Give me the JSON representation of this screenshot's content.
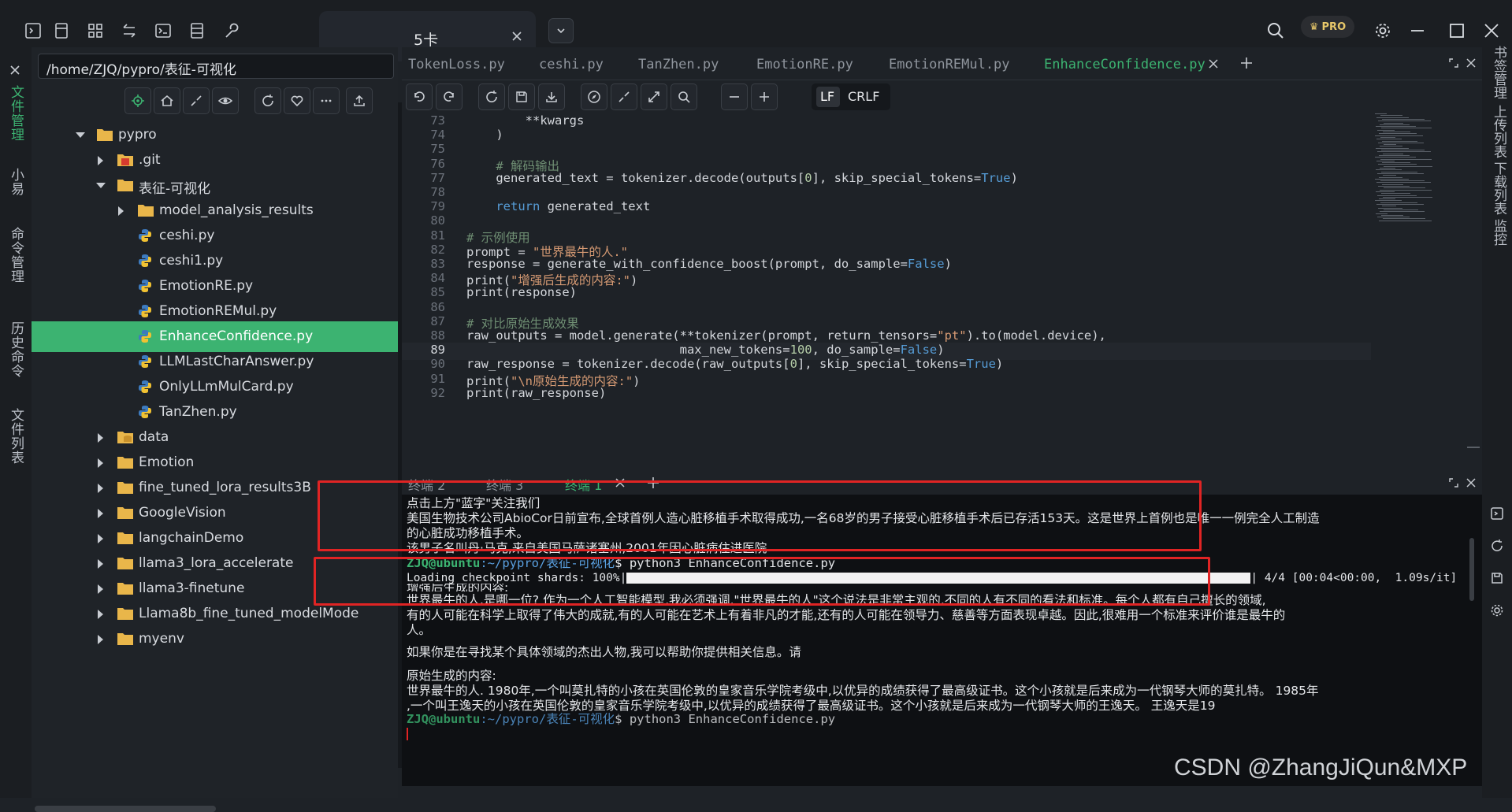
{
  "topbar": {
    "tab_title": "5卡",
    "pro_label": "PRO",
    "icons": [
      "terminal-icon",
      "bookmark-icon",
      "grid-icon",
      "transfer-icon",
      "shell-icon",
      "server-icon",
      "wrench-icon"
    ]
  },
  "left_rail": {
    "tabs": [
      "文件管理",
      "小易",
      "命令管理",
      "历史命令",
      "文件列表"
    ]
  },
  "right_rail": {
    "tabs": [
      "书签管理",
      "上传列表",
      "下载列表",
      "监控"
    ]
  },
  "file_panel": {
    "path": "/home/ZJQ/pypro/表征-可视化",
    "tree": [
      {
        "label": "pypro",
        "type": "folder",
        "depth": 0,
        "open": true
      },
      {
        "label": ".git",
        "type": "git",
        "depth": 1,
        "open": false
      },
      {
        "label": "表征-可视化",
        "type": "folder",
        "depth": 1,
        "open": true
      },
      {
        "label": "model_analysis_results",
        "type": "folder",
        "depth": 2,
        "open": false
      },
      {
        "label": "ceshi.py",
        "type": "py",
        "depth": 2
      },
      {
        "label": "ceshi1.py",
        "type": "py",
        "depth": 2
      },
      {
        "label": "EmotionRE.py",
        "type": "py",
        "depth": 2
      },
      {
        "label": "EmotionREMul.py",
        "type": "py",
        "depth": 2
      },
      {
        "label": "EnhanceConfidence.py",
        "type": "py",
        "depth": 2,
        "selected": true
      },
      {
        "label": "LLMLastCharAnswer.py",
        "type": "py",
        "depth": 2
      },
      {
        "label": "OnlyLLmMulCard.py",
        "type": "py",
        "depth": 2
      },
      {
        "label": "TanZhen.py",
        "type": "py",
        "depth": 2
      },
      {
        "label": "data",
        "type": "db",
        "depth": 1,
        "open": false
      },
      {
        "label": "Emotion",
        "type": "folder",
        "depth": 1,
        "open": false
      },
      {
        "label": "fine_tuned_lora_results3B",
        "type": "folder",
        "depth": 1,
        "open": false
      },
      {
        "label": "GoogleVision",
        "type": "folder",
        "depth": 1,
        "open": false
      },
      {
        "label": "langchainDemo",
        "type": "folder",
        "depth": 1,
        "open": false
      },
      {
        "label": "llama3_lora_accelerate",
        "type": "folder",
        "depth": 1,
        "open": false
      },
      {
        "label": "llama3-finetune",
        "type": "folder",
        "depth": 1,
        "open": false
      },
      {
        "label": "Llama8b_fine_tuned_modelMode",
        "type": "folder",
        "depth": 1,
        "open": false
      },
      {
        "label": "myenv",
        "type": "folder",
        "depth": 1,
        "open": false
      }
    ]
  },
  "editor": {
    "tabs": [
      "TokenLoss.py",
      "ceshi.py",
      "TanZhen.py",
      "EmotionRE.py",
      "EmotionREMul.py",
      "EnhanceConfidence.py"
    ],
    "active_tab": "EnhanceConfidence.py",
    "eol": {
      "lf": "LF",
      "crlf": "CRLF"
    },
    "current_line": 89,
    "lines": [
      {
        "n": "73",
        "text": "        **kwargs"
      },
      {
        "n": "74",
        "text": "    )"
      },
      {
        "n": "75",
        "text": ""
      },
      {
        "n": "76",
        "text": "    # 解码输出"
      },
      {
        "n": "77",
        "text": "    generated_text = tokenizer.decode(outputs[0], skip_special_tokens=True)"
      },
      {
        "n": "78",
        "text": ""
      },
      {
        "n": "79",
        "text": "    return generated_text"
      },
      {
        "n": "80",
        "text": ""
      },
      {
        "n": "81",
        "text": "# 示例使用"
      },
      {
        "n": "82",
        "text": "prompt = \"世界最牛的人.\""
      },
      {
        "n": "83",
        "text": "response = generate_with_confidence_boost(prompt, do_sample=False)"
      },
      {
        "n": "84",
        "text": "print(\"增强后生成的内容:\")"
      },
      {
        "n": "85",
        "text": "print(response)"
      },
      {
        "n": "86",
        "text": ""
      },
      {
        "n": "87",
        "text": "# 对比原始生成效果"
      },
      {
        "n": "88",
        "text": "raw_outputs = model.generate(**tokenizer(prompt, return_tensors=\"pt\").to(model.device),"
      },
      {
        "n": "89",
        "text": "                             max_new_tokens=100, do_sample=False)"
      },
      {
        "n": "90",
        "text": "raw_response = tokenizer.decode(raw_outputs[0], skip_special_tokens=True)"
      },
      {
        "n": "91",
        "text": "print(\"\\n原始生成的内容:\")"
      },
      {
        "n": "92",
        "text": "print(raw_response)"
      }
    ]
  },
  "terminal": {
    "tabs": [
      "终端 2",
      "终端 3",
      "终端 1"
    ],
    "active_tab": "终端 1",
    "lines": {
      "l1": "点击上方\"蓝字\"关注我们",
      "l2": "美国生物技术公司AbioCor日前宣布,全球首例人造心脏移植手术取得成功,一名68岁的男子接受心脏移植手术后已存活153天。这是世界上首例也是唯一一例完全人工制造",
      "l3": "的心脏成功移植手术。",
      "l4": "该男子名叫丹·马克,来自美国马萨诸塞州,2001年因心脏病住进医院",
      "prompt_user": "ZJQ@ubuntu",
      "prompt_path": ":~/pypro/表征-可视化",
      "cmd": "$ python3 EnhanceConfidence.py",
      "loading": "Loading checkpoint shards: 100%|",
      "loading_tail": "| 4/4 [00:04<00:00,  1.09s/it]",
      "enh_header": "增强后生成的内容:",
      "enh1": "世界最牛的人.是哪一位? 作为一个人工智能模型,我必须强调,\"世界最牛的人\"这个说法是非常主观的,不同的人有不同的看法和标准。每个人都有自己擅长的领域,",
      "enh2": "有的人可能在科学上取得了伟大的成就,有的人可能在艺术上有着非凡的才能,还有的人可能在领导力、慈善等方面表现卓越。因此,很难用一个标准来评价谁是最牛的",
      "enh3": "人。",
      "enh4": "如果你是在寻找某个具体领域的杰出人物,我可以帮助你提供相关信息。请",
      "raw_header": "原始生成的内容:",
      "raw1": "世界最牛的人. 1980年,一个叫莫扎特的小孩在英国伦敦的皇家音乐学院考级中,以优异的成绩获得了最高级证书。这个小孩就是后来成为一代钢琴大师的莫扎特。 1985年",
      "raw2": ",一个叫王逸天的小孩在英国伦敦的皇家音乐学院考级中,以优异的成绩获得了最高级证书。这个小孩就是后来成为一代钢琴大师的王逸天。 王逸天是19",
      "cmd2": "$ python3 EnhanceConfidence.py"
    }
  },
  "watermark": "CSDN @ZhangJiQun&MXP",
  "colors": {
    "accent": "#3cb371",
    "highlight_box": "#e02424"
  }
}
